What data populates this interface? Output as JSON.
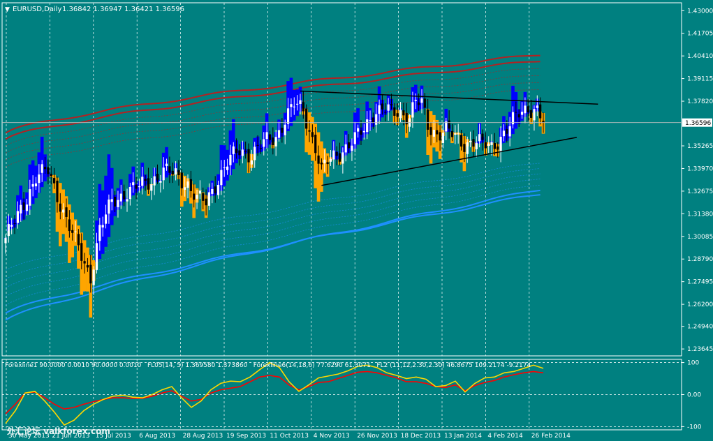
{
  "header": {
    "arrow": "▼",
    "symbol": "EURUSD,Daily",
    "ohlc": "1.36842 1.36947 1.36421 1.36596"
  },
  "indicator_header": "Forexline1 90.0000 0.0010 90.0000 0.0010   FL05(14, 5) 1.369580 1.373860   Forexline6(14,18,6) 77.6290 61.3071   FL2 (11,12,2.30,2.30) 46.8675 109.2174 -9.2174",
  "watermark": "外汇论坛 valkforex.com",
  "colors": {
    "background": "#008080",
    "grid": "#ffffff",
    "frame": "#ffffff",
    "bull_candle": "#ffffff",
    "bear_candle": "#000000",
    "band_upper": "#b22222",
    "band_lower": "#1e90ff",
    "hist_blue": "#0000ff",
    "hist_orange": "#ffa500",
    "trendline": "#000000",
    "osc_red": "#ff0000",
    "osc_yellow": "#ffd700",
    "price_label_bg": "#ffffff"
  },
  "chart_data": [
    {
      "type": "candlestick",
      "title": "EURUSD,Daily",
      "ylim": [
        1.2325,
        1.4345
      ],
      "y_ticks": [
        "1.43000",
        "1.41705",
        "1.40410",
        "1.39115",
        "1.37820",
        "1.36596",
        "1.35265",
        "1.33970",
        "1.32675",
        "1.31380",
        "1.30085",
        "1.28790",
        "1.27495",
        "1.26200",
        "1.24940",
        "1.23645"
      ],
      "x_labels": [
        "30 May 2013",
        "21 Jun 2013",
        "15 Jul 2013",
        "6 Aug 2013",
        "28 Aug 2013",
        "19 Sep 2013",
        "11 Oct 2013",
        "4 Nov 2013",
        "26 Nov 2013",
        "18 Dec 2013",
        "13 Jan 2014",
        "4 Feb 2014",
        "26 Feb 2014"
      ],
      "last_price": 1.36596,
      "close_anchors": [
        [
          0,
          1.3
        ],
        [
          4,
          1.312
        ],
        [
          10,
          1.335
        ],
        [
          14,
          1.338
        ],
        [
          18,
          1.32
        ],
        [
          22,
          1.302
        ],
        [
          26,
          1.285
        ],
        [
          28,
          1.278
        ],
        [
          31,
          1.305
        ],
        [
          35,
          1.32
        ],
        [
          40,
          1.327
        ],
        [
          44,
          1.329
        ],
        [
          48,
          1.333
        ],
        [
          52,
          1.338
        ],
        [
          56,
          1.336
        ],
        [
          60,
          1.331
        ],
        [
          63,
          1.322
        ],
        [
          66,
          1.32
        ],
        [
          69,
          1.331
        ],
        [
          73,
          1.343
        ],
        [
          77,
          1.35
        ],
        [
          81,
          1.348
        ],
        [
          85,
          1.354
        ],
        [
          89,
          1.358
        ],
        [
          92,
          1.368
        ],
        [
          95,
          1.376
        ],
        [
          98,
          1.373
        ],
        [
          100,
          1.362
        ],
        [
          102,
          1.352
        ],
        [
          104,
          1.338
        ],
        [
          106,
          1.343
        ],
        [
          109,
          1.348
        ],
        [
          112,
          1.352
        ],
        [
          115,
          1.356
        ],
        [
          118,
          1.362
        ],
        [
          121,
          1.372
        ],
        [
          124,
          1.374
        ],
        [
          127,
          1.371
        ],
        [
          130,
          1.372
        ],
        [
          133,
          1.37
        ],
        [
          135,
          1.378
        ],
        [
          137,
          1.376
        ],
        [
          139,
          1.364
        ],
        [
          142,
          1.36
        ],
        [
          145,
          1.362
        ],
        [
          148,
          1.357
        ],
        [
          151,
          1.354
        ],
        [
          154,
          1.356
        ],
        [
          157,
          1.353
        ],
        [
          160,
          1.352
        ],
        [
          163,
          1.358
        ],
        [
          166,
          1.364
        ],
        [
          169,
          1.371
        ],
        [
          172,
          1.375
        ],
        [
          175,
          1.373
        ],
        [
          177,
          1.366
        ]
      ],
      "upper_bands": [
        {
          "start": 1.36,
          "end": 1.405
        },
        {
          "start": 1.3565,
          "end": 1.4015
        },
        {
          "start": 1.3525,
          "end": 1.3975
        },
        {
          "start": 1.3485,
          "end": 1.3935
        },
        {
          "start": 1.3445,
          "end": 1.3895
        },
        {
          "start": 1.3405,
          "end": 1.3855
        }
      ],
      "lower_bands": [
        {
          "start": 1.253,
          "end": 1.328
        },
        {
          "start": 1.257,
          "end": 1.3255
        },
        {
          "start": 1.2615,
          "end": 1.331
        },
        {
          "start": 1.2665,
          "end": 1.3345
        },
        {
          "start": 1.2715,
          "end": 1.3375
        },
        {
          "start": 1.2765,
          "end": 1.3405
        },
        {
          "start": 1.2815,
          "end": 1.3435
        }
      ],
      "trendlines": [
        {
          "x1": 97,
          "y1": 1.384,
          "x2": 195,
          "y2": 1.3765
        },
        {
          "x1": 104,
          "y1": 1.33,
          "x2": 188,
          "y2": 1.3575
        }
      ]
    },
    {
      "type": "line",
      "title": "indicator",
      "ylim": [
        -110,
        110
      ],
      "y_ticks": [
        "100",
        "0.00",
        "-100"
      ],
      "series": [
        {
          "color": "red",
          "values": [
            -60,
            -30,
            5,
            8,
            -10,
            -30,
            -45,
            -40,
            -30,
            -22,
            -15,
            -10,
            -10,
            -12,
            -12,
            -5,
            5,
            12,
            -5,
            -20,
            -15,
            5,
            15,
            20,
            25,
            40,
            55,
            60,
            55,
            30,
            15,
            25,
            38,
            40,
            50,
            60,
            70,
            72,
            68,
            60,
            52,
            40,
            40,
            35,
            25,
            22,
            30,
            12,
            28,
            38,
            44,
            55,
            62,
            68,
            72,
            68
          ]
        },
        {
          "color": "yellow",
          "values": [
            -90,
            -50,
            5,
            10,
            -20,
            -55,
            -95,
            -80,
            -50,
            -30,
            -15,
            -5,
            -2,
            -8,
            -10,
            0,
            15,
            25,
            -10,
            -40,
            -20,
            15,
            35,
            42,
            40,
            55,
            78,
            100,
            85,
            40,
            10,
            30,
            52,
            58,
            64,
            74,
            88,
            92,
            84,
            68,
            60,
            50,
            55,
            48,
            25,
            28,
            42,
            8,
            35,
            52,
            55,
            68,
            72,
            82,
            92,
            82
          ]
        }
      ]
    }
  ]
}
